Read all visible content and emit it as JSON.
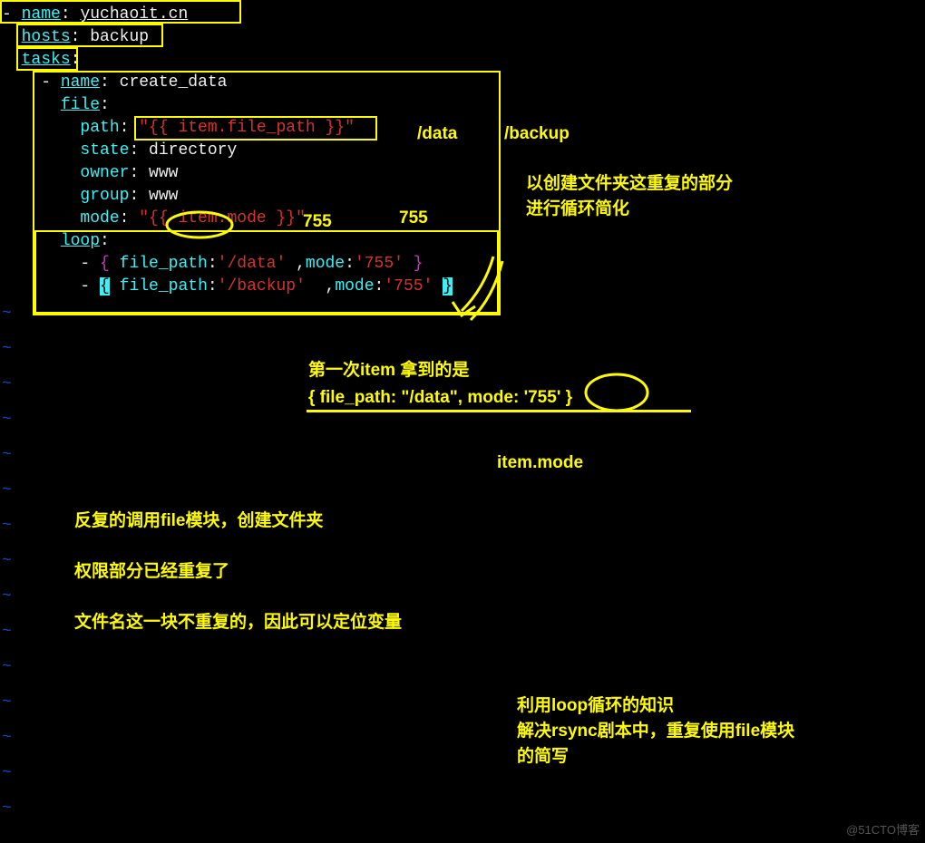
{
  "code": {
    "l1_name": "name",
    "l1_val": "yuchaoit.cn",
    "l2_hosts": "hosts",
    "l2_val": "backup",
    "l3_tasks": "tasks",
    "l4_name": "name",
    "l4_val": "create_data",
    "l5_file": "file",
    "l6_path": "path",
    "l6_val": "\"{{ item.file_path }}\"",
    "l7_state": "state",
    "l7_val": "directory",
    "l8_owner": "owner",
    "l8_val": "www",
    "l9_group": "group",
    "l9_val": "www",
    "l10_mode": "mode",
    "l10_val": "\"{{ item.mode }}\"",
    "l11_loop": "loop",
    "l12_a": "{ ",
    "l12_fp": "file_path",
    "l12_fpv": "'/data'",
    "l12_m": "mode",
    "l12_mv": "'755'",
    "l12_b": " }",
    "l13_a": "{",
    "l13_fp": "file_path",
    "l13_fpv": "'/backup'",
    "l13_m": "mode",
    "l13_mv": "'755'",
    "l13_b": "}"
  },
  "annotations": {
    "a1": "/data",
    "a2": "/backup",
    "a3": "以创建文件夹这重复的部分",
    "a4": "进行循环简化",
    "a5": "755",
    "a6": "755",
    "a7": "第一次item 拿到的是",
    "a8": "{  file_path: \"/data\", mode: '755'  }",
    "a9": "item.mode",
    "a10": "反复的调用file模块，创建文件夹",
    "a11": "权限部分已经重复了",
    "a12": "文件名这一块不重复的，因此可以定位变量",
    "a13": "利用loop循环的知识",
    "a14": "解决rsync剧本中，重复使用file模块",
    "a15": "的简写"
  },
  "watermark": "@51CTO博客",
  "tilde": "~"
}
